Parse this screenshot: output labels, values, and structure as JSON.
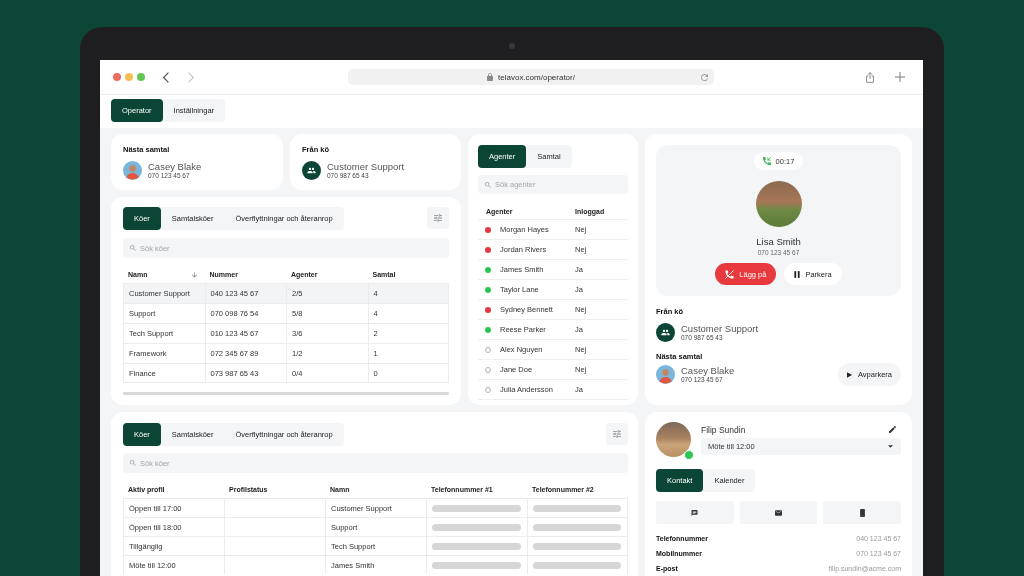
{
  "browser": {
    "url": "telavox.com/operator/",
    "can_go_back": true,
    "can_go_forward": false
  },
  "nav_tabs": [
    {
      "label": "Operator",
      "selected": true
    },
    {
      "label": "Inställningar",
      "selected": false
    }
  ],
  "next_call": {
    "title": "Nästa samtal",
    "name": "Casey Blake",
    "number": "070 123 45 67"
  },
  "from_queue": {
    "title": "Från kö",
    "name": "Customer Support",
    "number": "070 987 65 43"
  },
  "queues": {
    "tabs": [
      {
        "label": "Köer",
        "selected": true
      },
      {
        "label": "Samtalsköer",
        "selected": false
      },
      {
        "label": "Överflyttningar och återanrop",
        "selected": false
      }
    ],
    "search": {
      "placeholder": "Sök köer"
    },
    "columns": [
      {
        "label": "Namn",
        "sorted": true
      },
      {
        "label": "Nummer",
        "sorted": false
      },
      {
        "label": "Agenter",
        "sorted": false
      },
      {
        "label": "Samtal",
        "sorted": false
      }
    ],
    "rows": [
      {
        "cells": [
          "Customer Support",
          "040 123 45 67",
          "2/5",
          "4"
        ],
        "selected": true
      },
      {
        "cells": [
          "Support",
          "070 098 76 54",
          "5/8",
          "4"
        ],
        "selected": false
      },
      {
        "cells": [
          "Tech Support",
          "010 123 45 67",
          "3/6",
          "2"
        ],
        "selected": false
      },
      {
        "cells": [
          "Framework",
          "072 345 67 89",
          "1/2",
          "1"
        ],
        "selected": false
      },
      {
        "cells": [
          "Finance",
          "073 987 65 43",
          "0/4",
          "0"
        ],
        "selected": false
      }
    ]
  },
  "agents": {
    "tabs": [
      {
        "label": "Agenter",
        "selected": true
      },
      {
        "label": "Samtal",
        "selected": false
      }
    ],
    "search": {
      "placeholder": "Sök agenter"
    },
    "columns": [
      "Agenter",
      "Inloggad"
    ],
    "rows": [
      {
        "name": "Morgan Hayes",
        "logged_in": "Nej",
        "color": "#e8383d",
        "filled": true
      },
      {
        "name": "Jordan Rivers",
        "logged_in": "Nej",
        "color": "#e8383d",
        "filled": true
      },
      {
        "name": "James Smith",
        "logged_in": "Ja",
        "color": "#2fc552",
        "filled": true
      },
      {
        "name": "Taylor Lane",
        "logged_in": "Ja",
        "color": "#2fc552",
        "filled": true
      },
      {
        "name": "Sydney Bennett",
        "logged_in": "Nej",
        "color": "#e8383d",
        "filled": true
      },
      {
        "name": "Reese Parker",
        "logged_in": "Ja",
        "color": "#2fc552",
        "filled": true
      },
      {
        "name": "Alex Nguyen",
        "logged_in": "Nej",
        "color": "#b0b0b0",
        "filled": false
      },
      {
        "name": "Jane Doe",
        "logged_in": "Nej",
        "color": "#b0b0b0",
        "filled": false
      },
      {
        "name": "Julia Andersson",
        "logged_in": "Ja",
        "color": "#b0b0b0",
        "filled": false
      }
    ]
  },
  "active_call": {
    "timer": "00:17",
    "name": "Lisa Smith",
    "number": "070 123 45 67",
    "buttons": [
      {
        "label": "Lägg på",
        "kind": "hangup"
      },
      {
        "label": "Parkera",
        "kind": "park"
      }
    ],
    "from_queue": {
      "title": "Från kö",
      "name": "Customer Support",
      "number": "070 987 65 43"
    },
    "next_call": {
      "title": "Nästa samtal",
      "name": "Casey Blake",
      "number": "070 123 45 67",
      "button": "Avparkera"
    }
  },
  "profiles": {
    "tabs": [
      {
        "label": "Köer",
        "selected": true
      },
      {
        "label": "Samtalsköer",
        "selected": false
      },
      {
        "label": "Överflyttningar och återanrop",
        "selected": false
      }
    ],
    "search": {
      "placeholder": "Sök köer"
    },
    "columns": [
      "Aktiv profil",
      "Profilstatus",
      "Namn",
      "Telefonnummer #1",
      "Telefonnummer #2"
    ],
    "rows": [
      {
        "active_profile": "Öppen till 17:00",
        "name": "Customer Support",
        "loading": true
      },
      {
        "active_profile": "Öppen till 18:00",
        "name": "Support",
        "loading": true
      },
      {
        "active_profile": "Tillgänglig",
        "name": "Tech Support",
        "loading": true
      },
      {
        "active_profile": "Möte till 12:00",
        "name": "James Smith",
        "loading": true
      }
    ]
  },
  "contact": {
    "name": "Filip Sundin",
    "online": true,
    "status": "Möte till 12:00",
    "tabs": [
      {
        "label": "Kontakt",
        "selected": true
      },
      {
        "label": "Kalender",
        "selected": false
      }
    ],
    "actions": [
      {
        "kind": "message"
      },
      {
        "kind": "email"
      },
      {
        "kind": "mobile"
      }
    ],
    "details": [
      {
        "label": "Telefonnummer",
        "value": "040 123 45 67"
      },
      {
        "label": "Mobilnummer",
        "value": "070 123 45 67"
      },
      {
        "label": "E-post",
        "value": "filip.sundin@acme.com"
      }
    ]
  }
}
